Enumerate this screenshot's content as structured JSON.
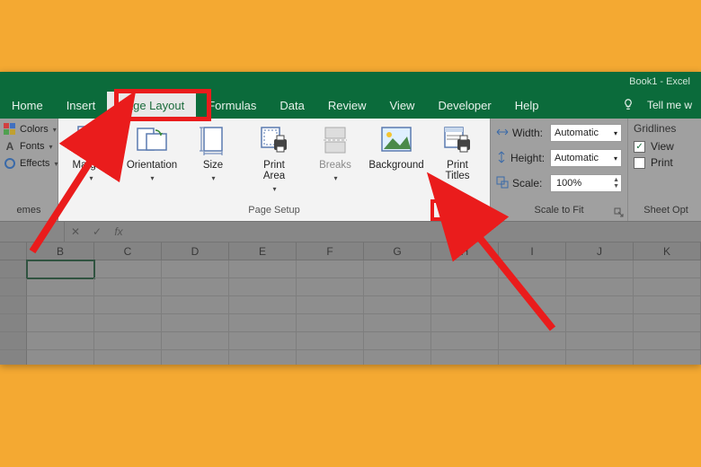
{
  "titlebar": {
    "doc_title": "Book1 - Excel"
  },
  "tabs": {
    "home": "Home",
    "insert": "Insert",
    "page_layout": "Page Layout",
    "formulas": "Formulas",
    "data": "Data",
    "review": "Review",
    "view": "View",
    "developer": "Developer",
    "help": "Help",
    "tell_me": "Tell me w"
  },
  "themes": {
    "colors": "Colors",
    "fonts": "Fonts",
    "effects": "Effects",
    "group_label": "emes"
  },
  "page_setup": {
    "margins": "Margins",
    "orientation": "Orientation",
    "size": "Size",
    "print_area": "Print\nArea",
    "breaks": "Breaks",
    "background": "Background",
    "print_titles": "Print\nTitles",
    "group_label": "Page Setup"
  },
  "scale_to_fit": {
    "width_label": "Width:",
    "height_label": "Height:",
    "scale_label": "Scale:",
    "width_value": "Automatic",
    "height_value": "Automatic",
    "scale_value": "100%",
    "group_label": "Scale to Fit"
  },
  "sheet_options": {
    "gridlines_label": "Gridlines",
    "view_label": "View",
    "print_label": "Print",
    "view_checked": true,
    "print_checked": false,
    "group_label": "Sheet Opt"
  },
  "formula_bar": {
    "fx": "fx"
  },
  "columns": [
    "B",
    "C",
    "D",
    "E",
    "F",
    "G",
    "H",
    "I",
    "J",
    "K"
  ]
}
